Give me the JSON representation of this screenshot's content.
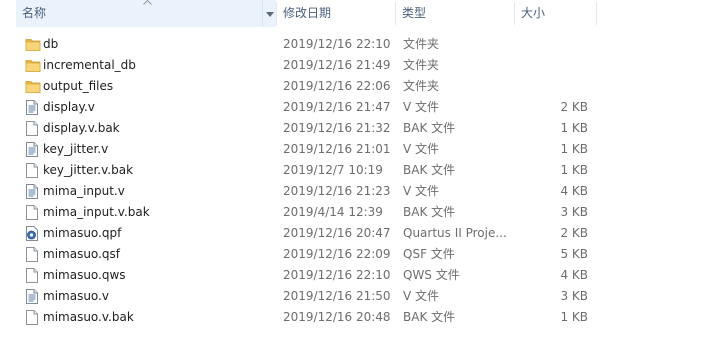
{
  "columns": {
    "name": "名称",
    "date": "修改日期",
    "type": "类型",
    "size": "大小"
  },
  "files": [
    {
      "name": "db",
      "date": "2019/12/16 22:10",
      "type": "文件夹",
      "size": "",
      "icon": "folder-icon"
    },
    {
      "name": "incremental_db",
      "date": "2019/12/16 21:49",
      "type": "文件夹",
      "size": "",
      "icon": "folder-icon"
    },
    {
      "name": "output_files",
      "date": "2019/12/16 22:06",
      "type": "文件夹",
      "size": "",
      "icon": "folder-icon"
    },
    {
      "name": "display.v",
      "date": "2019/12/16 21:47",
      "type": "V 文件",
      "size": "2 KB",
      "icon": "text-file-icon"
    },
    {
      "name": "display.v.bak",
      "date": "2019/12/16 21:32",
      "type": "BAK 文件",
      "size": "1 KB",
      "icon": "blank-file-icon"
    },
    {
      "name": "key_jitter.v",
      "date": "2019/12/16 21:01",
      "type": "V 文件",
      "size": "1 KB",
      "icon": "text-file-icon"
    },
    {
      "name": "key_jitter.v.bak",
      "date": "2019/12/7 10:19",
      "type": "BAK 文件",
      "size": "1 KB",
      "icon": "blank-file-icon"
    },
    {
      "name": "mima_input.v",
      "date": "2019/12/16 21:23",
      "type": "V 文件",
      "size": "4 KB",
      "icon": "text-file-icon"
    },
    {
      "name": "mima_input.v.bak",
      "date": "2019/4/14 12:39",
      "type": "BAK 文件",
      "size": "3 KB",
      "icon": "blank-file-icon"
    },
    {
      "name": "mimasuo.qpf",
      "date": "2019/12/16 20:47",
      "type": "Quartus II Proje...",
      "size": "2 KB",
      "icon": "quartus-project-icon"
    },
    {
      "name": "mimasuo.qsf",
      "date": "2019/12/16 22:09",
      "type": "QSF 文件",
      "size": "5 KB",
      "icon": "blank-file-icon"
    },
    {
      "name": "mimasuo.qws",
      "date": "2019/12/16 22:10",
      "type": "QWS 文件",
      "size": "4 KB",
      "icon": "blank-file-icon"
    },
    {
      "name": "mimasuo.v",
      "date": "2019/12/16 21:50",
      "type": "V 文件",
      "size": "3 KB",
      "icon": "text-file-icon"
    },
    {
      "name": "mimasuo.v.bak",
      "date": "2019/12/16 20:48",
      "type": "BAK 文件",
      "size": "1 KB",
      "icon": "blank-file-icon"
    }
  ]
}
